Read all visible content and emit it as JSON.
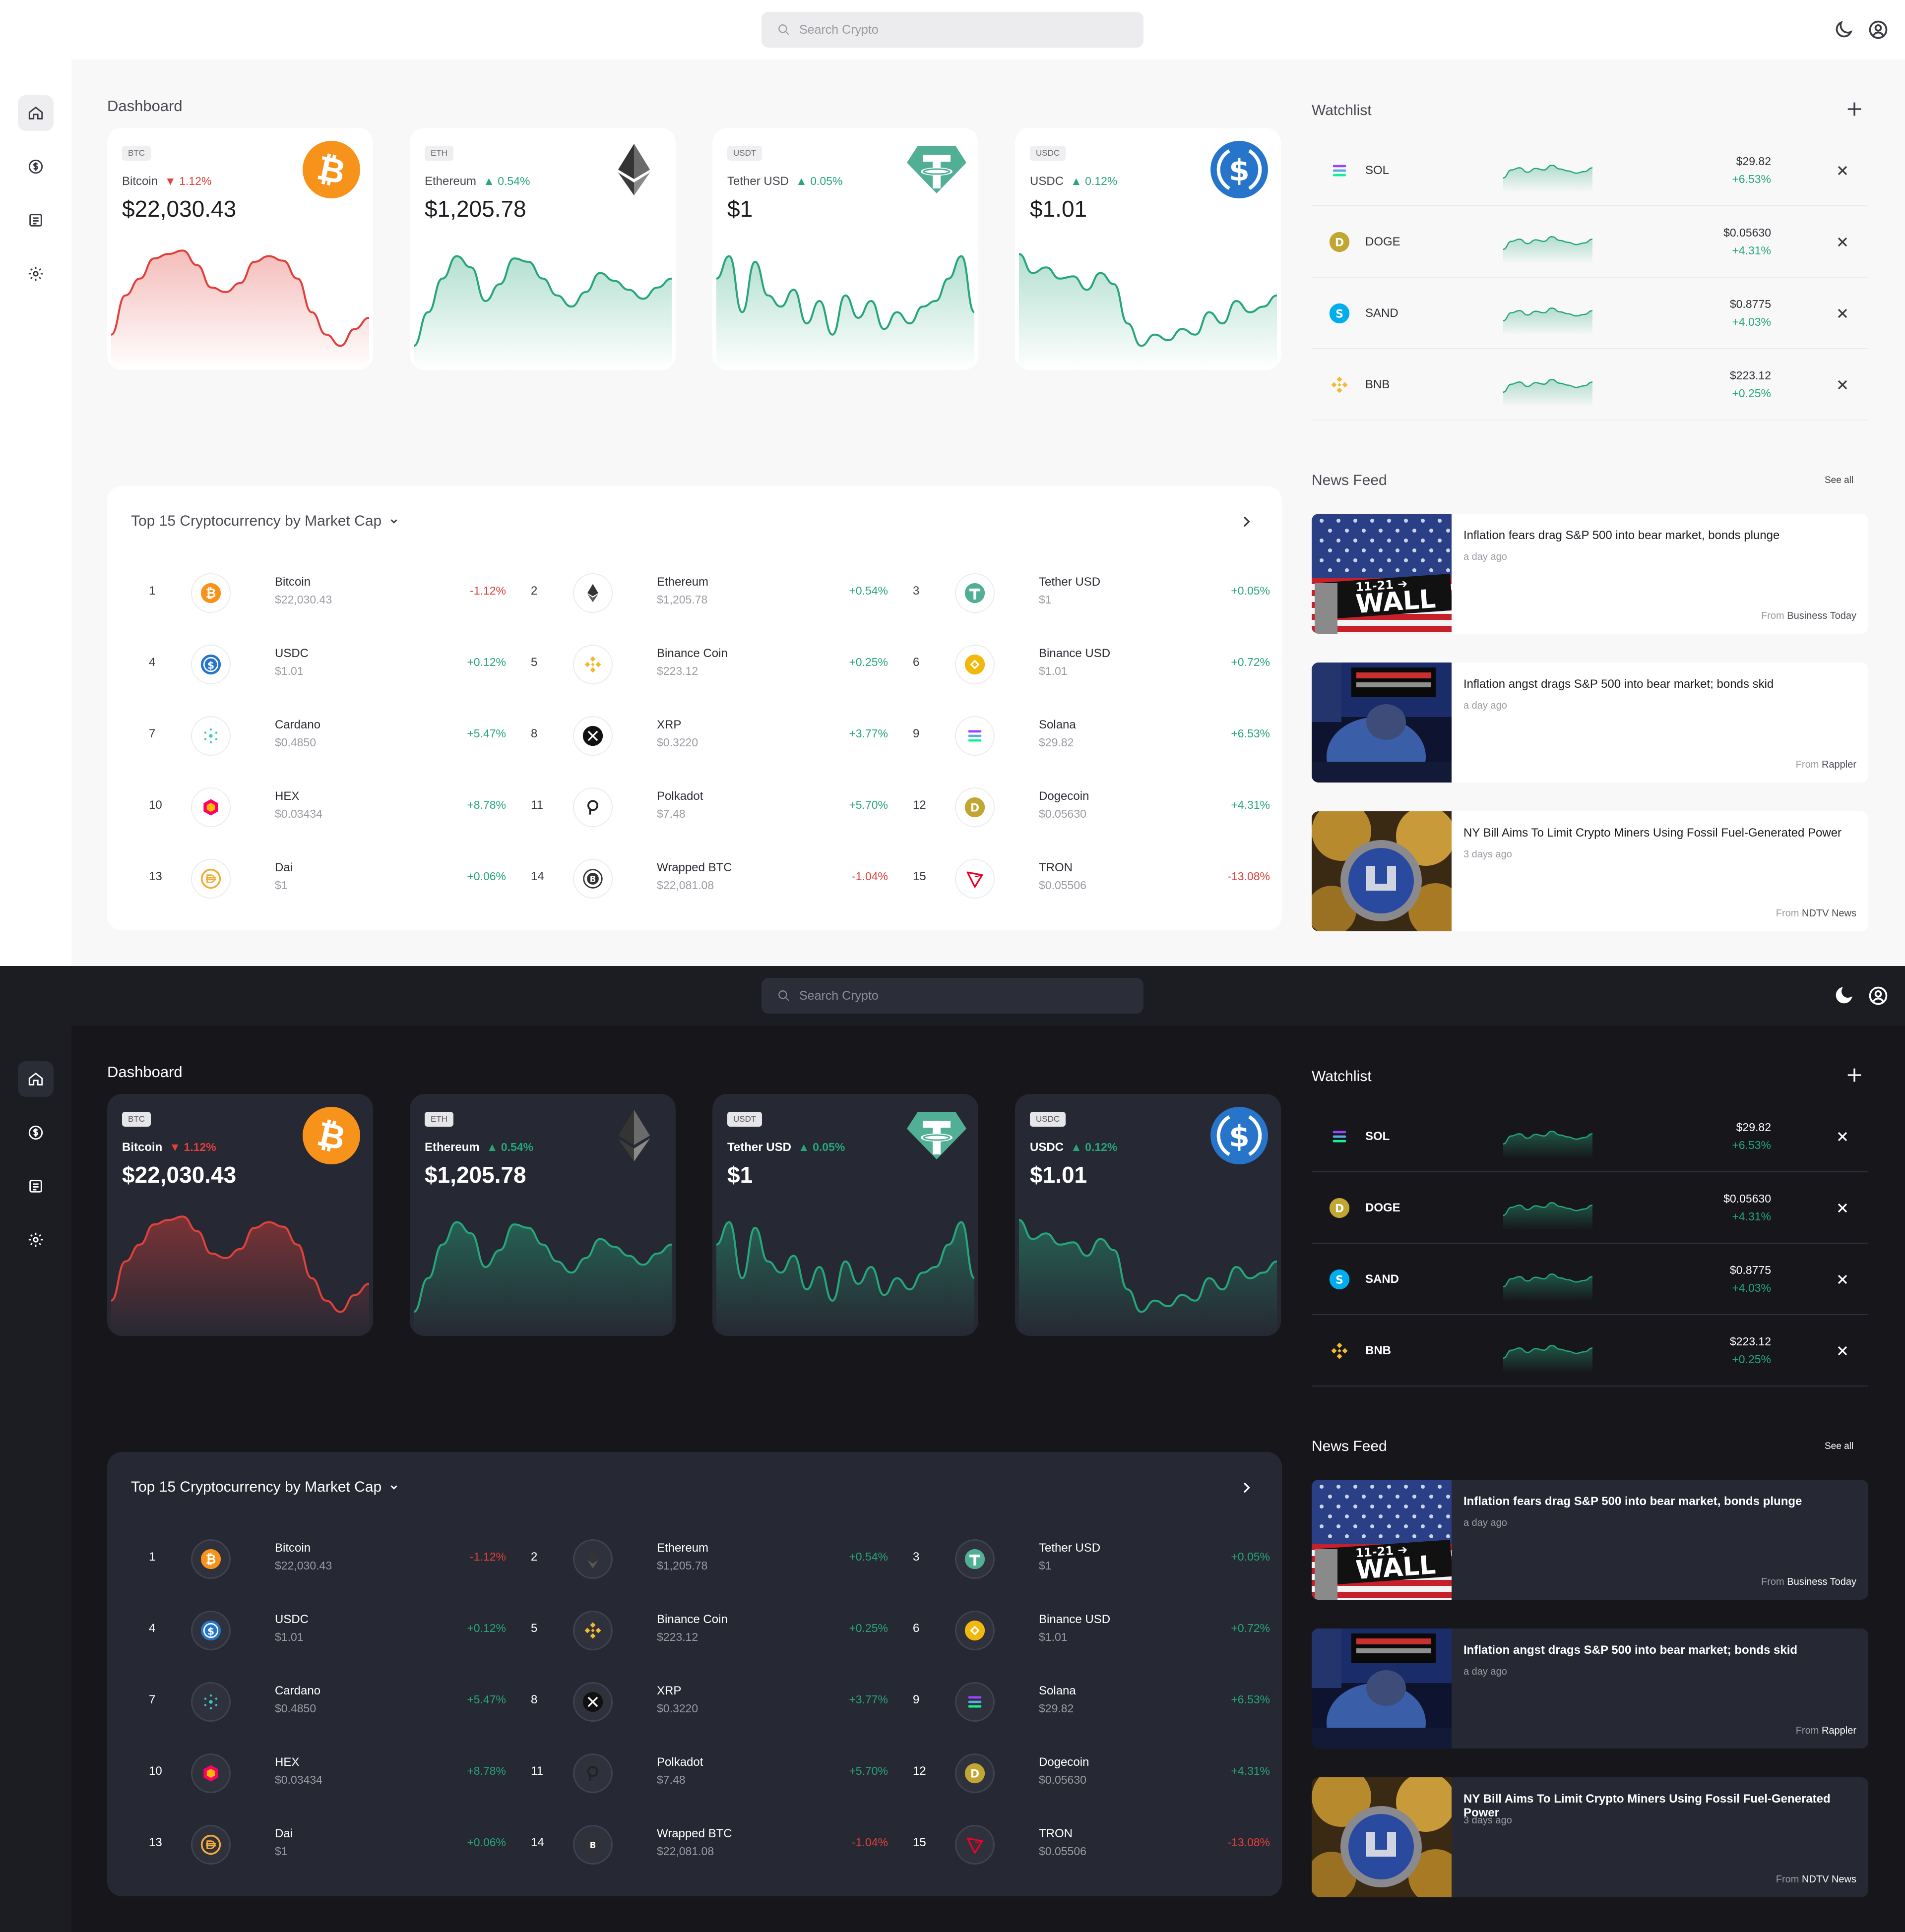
{
  "search": {
    "placeholder": "Search Crypto"
  },
  "themes": [
    "light",
    "dark"
  ],
  "nav": [
    {
      "name": "home"
    },
    {
      "name": "dollar"
    },
    {
      "name": "news"
    },
    {
      "name": "settings"
    }
  ],
  "dashboard": {
    "title": "Dashboard",
    "cards": [
      {
        "tag": "BTC",
        "name": "Bitcoin",
        "change": "1.12%",
        "direction": "down",
        "price": "$22,030.43",
        "color": "#e0413b",
        "logo": "bitcoin-logo",
        "series": [
          20,
          55,
          70,
          88,
          92,
          95,
          82,
          62,
          58,
          66,
          85,
          90,
          86,
          70,
          40,
          20,
          10,
          25,
          35
        ]
      },
      {
        "tag": "ETH",
        "name": "Ethereum",
        "change": "0.54%",
        "direction": "up",
        "price": "$1,205.78",
        "color": "#26a67a",
        "logo": "ethereum-logo",
        "series": [
          10,
          40,
          70,
          90,
          80,
          50,
          65,
          88,
          85,
          70,
          55,
          45,
          58,
          75,
          68,
          60,
          52,
          62,
          70
        ]
      },
      {
        "tag": "USDT",
        "name": "Tether USD",
        "change": "0.05%",
        "direction": "up",
        "price": "$1",
        "color": "#26a67a",
        "logo": "tether-logo",
        "series": [
          70,
          90,
          40,
          85,
          55,
          45,
          60,
          30,
          50,
          20,
          55,
          35,
          50,
          25,
          40,
          30,
          45,
          50,
          70,
          90,
          40
        ]
      },
      {
        "tag": "USDC",
        "name": "USDC",
        "change": "0.12%",
        "direction": "up",
        "price": "$1.01",
        "color": "#26a67a",
        "logo": "usdc-logo",
        "series": [
          92,
          75,
          80,
          70,
          72,
          60,
          75,
          65,
          30,
          10,
          20,
          15,
          25,
          20,
          40,
          30,
          50,
          40,
          45,
          55
        ]
      }
    ]
  },
  "top_list": {
    "title": "Top 15 Cryptocurrency by Market Cap",
    "items": [
      {
        "rank": "1",
        "name": "Bitcoin",
        "price": "$22,030.43",
        "change": "-1.12%",
        "direction": "down",
        "icon": "bitcoin-icon"
      },
      {
        "rank": "2",
        "name": "Ethereum",
        "price": "$1,205.78",
        "change": "+0.54%",
        "direction": "up",
        "icon": "ethereum-icon"
      },
      {
        "rank": "3",
        "name": "Tether USD",
        "price": "$1",
        "change": "+0.05%",
        "direction": "up",
        "icon": "tether-icon"
      },
      {
        "rank": "4",
        "name": "USDC",
        "price": "$1.01",
        "change": "+0.12%",
        "direction": "up",
        "icon": "usdc-icon"
      },
      {
        "rank": "5",
        "name": "Binance Coin",
        "price": "$223.12",
        "change": "+0.25%",
        "direction": "up",
        "icon": "binance-icon"
      },
      {
        "rank": "6",
        "name": "Binance USD",
        "price": "$1.01",
        "change": "+0.72%",
        "direction": "up",
        "icon": "binance-usd-icon"
      },
      {
        "rank": "7",
        "name": "Cardano",
        "price": "$0.4850",
        "change": "+5.47%",
        "direction": "up",
        "icon": "cardano-icon"
      },
      {
        "rank": "8",
        "name": "XRP",
        "price": "$0.3220",
        "change": "+3.77%",
        "direction": "up",
        "icon": "xrp-icon"
      },
      {
        "rank": "9",
        "name": "Solana",
        "price": "$29.82",
        "change": "+6.53%",
        "direction": "up",
        "icon": "solana-icon"
      },
      {
        "rank": "10",
        "name": "HEX",
        "price": "$0.03434",
        "change": "+8.78%",
        "direction": "up",
        "icon": "hex-icon"
      },
      {
        "rank": "11",
        "name": "Polkadot",
        "price": "$7.48",
        "change": "+5.70%",
        "direction": "up",
        "icon": "polkadot-icon"
      },
      {
        "rank": "12",
        "name": "Dogecoin",
        "price": "$0.05630",
        "change": "+4.31%",
        "direction": "up",
        "icon": "dogecoin-icon"
      },
      {
        "rank": "13",
        "name": "Dai",
        "price": "$1",
        "change": "+0.06%",
        "direction": "up",
        "icon": "dai-icon"
      },
      {
        "rank": "14",
        "name": "Wrapped BTC",
        "price": "$22,081.08",
        "change": "-1.04%",
        "direction": "down",
        "icon": "wrapped-btc-icon"
      },
      {
        "rank": "15",
        "name": "TRON",
        "price": "$0.05506",
        "change": "-13.08%",
        "direction": "down",
        "icon": "tron-icon"
      }
    ]
  },
  "watchlist": {
    "title": "Watchlist",
    "items": [
      {
        "symbol": "SOL",
        "price": "$29.82",
        "change": "+6.53%",
        "icon": "solana-icon"
      },
      {
        "symbol": "DOGE",
        "price": "$0.05630",
        "change": "+4.31%",
        "icon": "dogecoin-icon"
      },
      {
        "symbol": "SAND",
        "price": "$0.8775",
        "change": "+4.03%",
        "icon": "sand-icon"
      },
      {
        "symbol": "BNB",
        "price": "$223.12",
        "change": "+0.25%",
        "icon": "binance-icon"
      }
    ]
  },
  "news": {
    "title": "News Feed",
    "see_all": "See all",
    "items": [
      {
        "title": "Inflation fears drag S&P 500 into bear market, bonds plunge",
        "ago": "a day ago",
        "from": "From",
        "source": "Business Today",
        "image": "wall-street-sign"
      },
      {
        "title": "Inflation angst drags S&P 500 into bear market; bonds skid",
        "ago": "a day ago",
        "from": "From",
        "source": "Rappler",
        "image": "trader-at-screens"
      },
      {
        "title": "NY Bill Aims To Limit Crypto Miners Using Fossil Fuel-Generated Power",
        "ago": "3 days ago",
        "from": "From",
        "source": "NDTV News",
        "image": "crypto-coins"
      }
    ]
  },
  "colors": {
    "up": "#26a67a",
    "down": "#e0413b",
    "accent_btc": "#f7931a",
    "accent_usdc": "#2775ca",
    "accent_tether": "#50af95"
  }
}
